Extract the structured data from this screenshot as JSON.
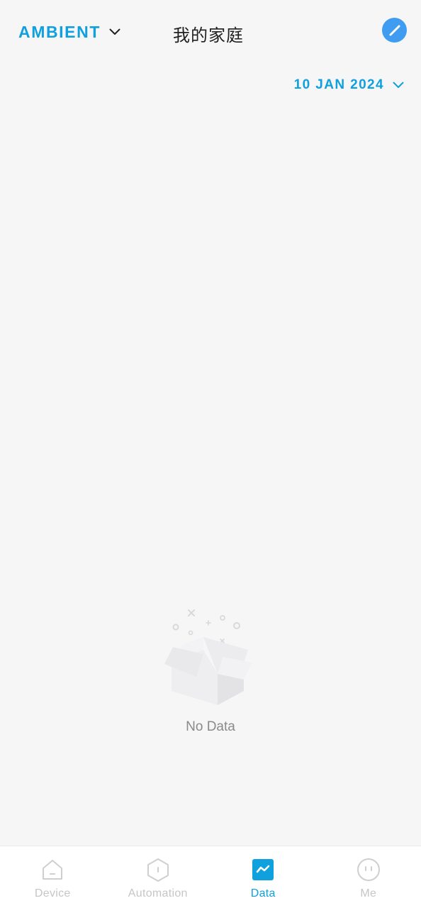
{
  "header": {
    "category_label": "AMBIENT",
    "home_title": "我的家庭",
    "accent_color": "#0fa0de",
    "edit_button_color": "#3f9cf0"
  },
  "date_selector": {
    "value": "10 JAN 2024"
  },
  "empty_state": {
    "message": "No Data",
    "icon": "empty-box-icon"
  },
  "tabbar": {
    "tabs": [
      {
        "label": "Device",
        "icon": "home-icon",
        "active": false
      },
      {
        "label": "Automation",
        "icon": "hexagon-icon",
        "active": false
      },
      {
        "label": "Data",
        "icon": "chart-icon",
        "active": true
      },
      {
        "label": "Me",
        "icon": "face-icon",
        "active": false
      }
    ],
    "active_color": "#0fa0de",
    "inactive_color": "#c6c6c6"
  }
}
